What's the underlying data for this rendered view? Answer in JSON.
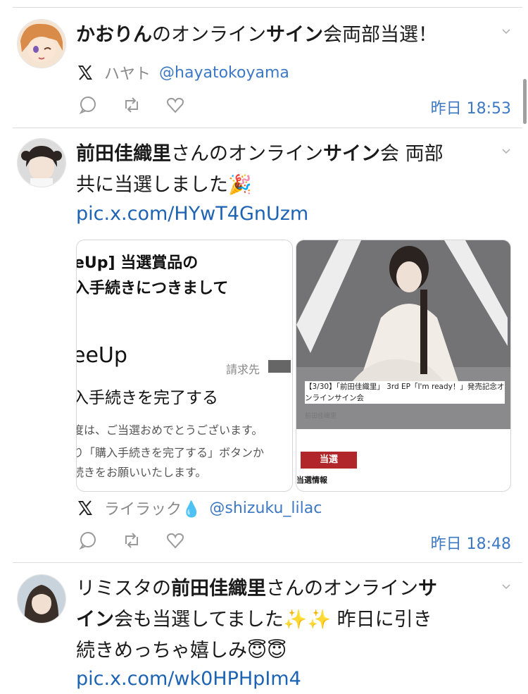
{
  "posts": [
    {
      "text_parts": [
        {
          "t": "かおりん",
          "b": true
        },
        {
          "t": "のオンライン",
          "b": false
        },
        {
          "t": "サイン",
          "b": true
        },
        {
          "t": "会両部当選！",
          "b": false
        }
      ],
      "source_name": "ハヤト",
      "source_handle": "@hayatokoyama",
      "time": "昨日 18:53"
    },
    {
      "text_line1_parts": [
        {
          "t": "前田佳織里",
          "b": true
        },
        {
          "t": "さんのオンライン",
          "b": false
        },
        {
          "t": "サイン",
          "b": true
        },
        {
          "t": "会 両部",
          "b": false
        }
      ],
      "text_line2": "共に当選しました🎉",
      "link": "pic.x.com/HYwT4GnUzm",
      "card_left": {
        "l1": "eUp] 当選賞品の",
        "l2": "入手続きにつきまして",
        "l3": "eeUp",
        "l4": "請求先",
        "l5": "入手続きを完了する",
        "l6": "度は、ご当選おめでとうございます。",
        "l7": "り「購入手続きを完了する」ボタンか",
        "l8": "続きをお願いいたします。"
      },
      "card_right": {
        "caption": "【3/30】「前田佳織里」 3rd EP「I'm ready！」発売記念オンラインサイン会",
        "artist": "前田佳織里",
        "badge": "当選",
        "info": "当選情報"
      },
      "source_name": "ライラック💧",
      "source_handle": "@shizuku_lilac",
      "time": "昨日 18:48"
    },
    {
      "text_line1_parts": [
        {
          "t": "リミスタの",
          "b": false
        },
        {
          "t": "前田佳織里",
          "b": true
        },
        {
          "t": "さんのオンライン",
          "b": false
        },
        {
          "t": "サ",
          "b": true
        }
      ],
      "text_line2_parts": [
        {
          "t": "イン",
          "b": true
        },
        {
          "t": "会も当選してました✨✨ 昨日に引き",
          "b": false
        }
      ],
      "text_line3": "続きめっちゃ嬉しみ😇😇",
      "link": "pic.x.com/wk0HPHpIm4"
    }
  ]
}
